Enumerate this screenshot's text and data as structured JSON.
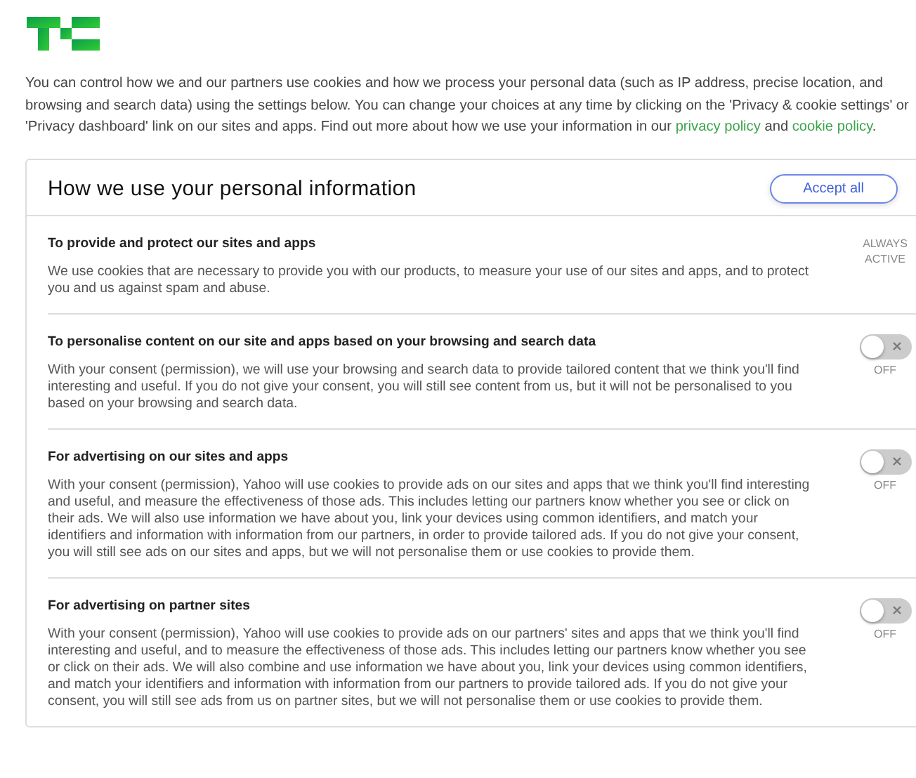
{
  "intro": [
    {
      "kind": "text",
      "text": "You can control how we and our partners use cookies and how we process your personal data (such as IP address, precise location, and browsing and search data) using the settings below. You can change your choices at any time by clicking on the 'Privacy & cookie settings' or 'Privacy dashboard' link on our sites and apps. Find out more about how we use your information in our "
    },
    {
      "kind": "link",
      "text": "privacy policy"
    },
    {
      "kind": "text",
      "text": " and "
    },
    {
      "kind": "link",
      "text": "cookie policy"
    },
    {
      "kind": "text",
      "text": "."
    }
  ],
  "panel": {
    "title": "How we use your personal information",
    "accept_button": "Accept all",
    "sections": [
      {
        "kind": "always",
        "title": "To provide and protect our sites and apps",
        "description": "We use cookies that are necessary to provide you with our products, to measure your use of our sites and apps, and to protect you and us against spam and abuse.",
        "status": "ALWAYS ACTIVE"
      },
      {
        "kind": "toggle",
        "title": "To personalise content on our site and apps based on your browsing and search data",
        "description": "With your consent (permission), we will use your browsing and search data to provide tailored content that we think you'll find interesting and useful. If you do not give your consent, you will still see content from us, but it will not be personalised to you based on your browsing and search data.",
        "on": false,
        "status": "OFF"
      },
      {
        "kind": "toggle",
        "title": "For advertising on our sites and apps",
        "description": "With your consent (permission), Yahoo will use cookies to provide ads on our sites and apps that we think you'll find interesting and useful, and measure the effectiveness of those ads. This includes letting our partners know whether you see or click on their ads. We will also use information we have about you, link your devices using common identifiers, and match your identifiers and information with information from our partners, in order to provide tailored ads. If you do not give your consent, you will still see ads on our sites and apps, but we will not personalise them or use cookies to provide them.",
        "on": false,
        "status": "OFF"
      },
      {
        "kind": "toggle",
        "title": "For advertising on partner sites",
        "description": "With your consent (permission), Yahoo will use cookies to provide ads on our partners' sites and apps that we think you'll find interesting and useful, and to measure the effectiveness of those ads. This includes letting our partners know whether you see or click on their ads. We will also combine and use information we have about you, link your devices using common identifiers, and match your identifiers and information with information from our partners to provide tailored ads. If you do not give your consent, you will still see ads from us on partner sites, but we will not personalise them or use cookies to provide them.",
        "on": false,
        "status": "OFF"
      }
    ]
  }
}
